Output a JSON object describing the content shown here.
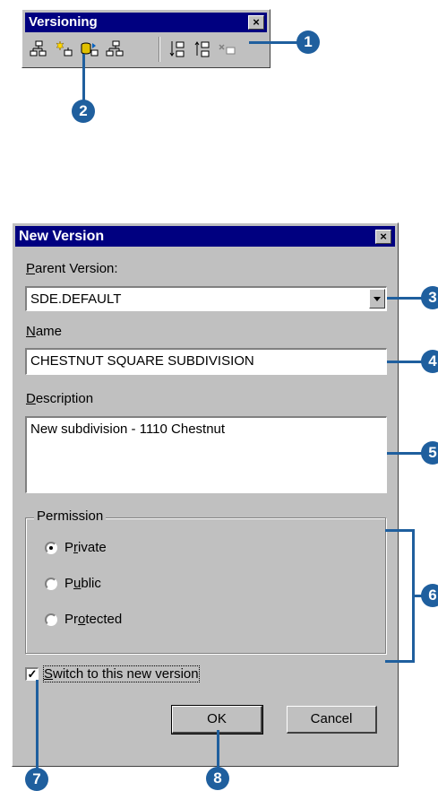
{
  "toolbar": {
    "title": "Versioning",
    "close_label": "×",
    "icons": [
      "manage-versions-icon",
      "create-version-icon",
      "refresh-icon",
      "change-version-icon",
      "reconcile-icon",
      "post-icon",
      "delete-version-icon"
    ]
  },
  "dialog": {
    "title": "New Version",
    "close_label": "×",
    "parent_label_u": "P",
    "parent_label_rest": "arent Version:",
    "parent_value": "SDE.DEFAULT",
    "name_label_u": "N",
    "name_label_rest": "ame",
    "name_value": "CHESTNUT SQUARE SUBDIVISION",
    "desc_label_u": "D",
    "desc_label_rest": "escription",
    "desc_value": "New subdivision - 1110 Chestnut",
    "permission_label": "Permission",
    "options": [
      {
        "pre": "P",
        "u": "r",
        "post": "ivate",
        "selected": true
      },
      {
        "pre": "P",
        "u": "u",
        "post": "blic",
        "selected": false
      },
      {
        "pre": "Pr",
        "u": "o",
        "post": "tected",
        "selected": false
      }
    ],
    "switch_label_u": "S",
    "switch_label_rest": "witch to this new version",
    "switch_checked": true,
    "check_mark": "✓",
    "ok_label": "OK",
    "cancel_label": "Cancel"
  },
  "callouts": [
    "1",
    "2",
    "3",
    "4",
    "5",
    "6",
    "7",
    "8"
  ],
  "colors": {
    "callout": "#1f5f9e",
    "titlebar": "#000080",
    "face": "#c0c0c0"
  }
}
